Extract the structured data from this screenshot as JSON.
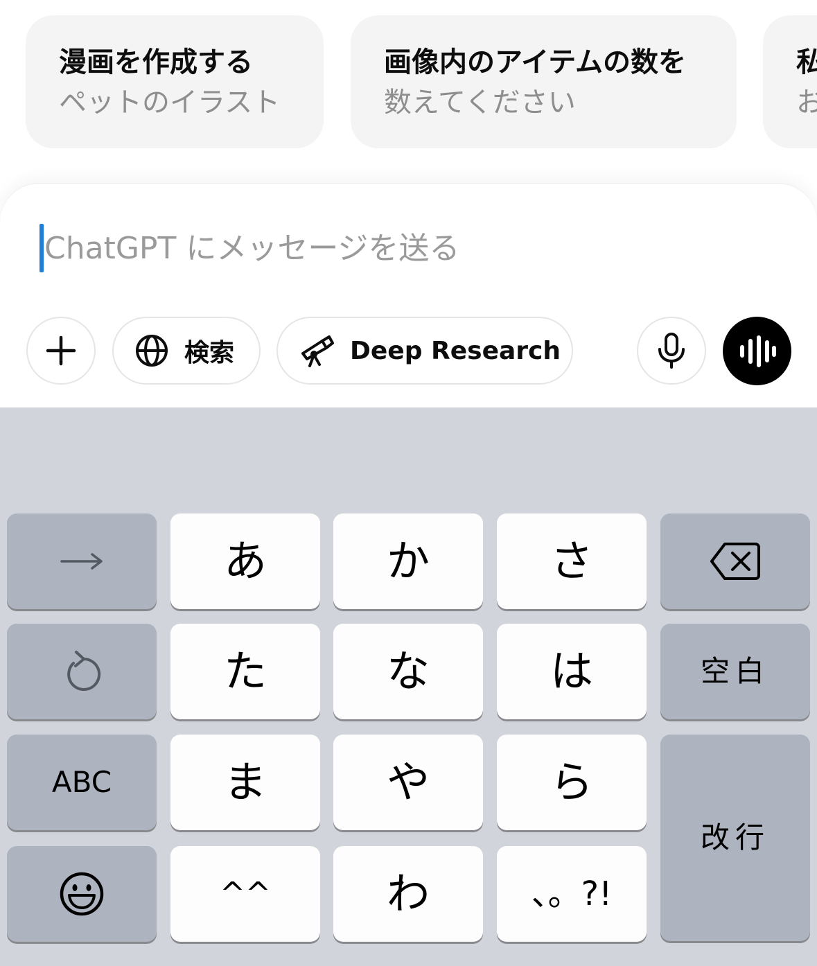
{
  "suggestions": [
    {
      "title": "漫画を作成する",
      "subtitle": "ペットのイラスト"
    },
    {
      "title": "画像内のアイテムの数を",
      "subtitle": "数えてください"
    },
    {
      "title": "私",
      "subtitle": "お"
    }
  ],
  "composer": {
    "placeholder": "ChatGPT にメッセージを送る",
    "search_label": "検索",
    "deep_research_label": "Deep Research"
  },
  "icons": {
    "add": "plus-icon",
    "search": "globe-icon",
    "deep_research": "telescope-icon",
    "dictation": "microphone-icon",
    "voice_mode": "voice-waveform-icon",
    "next": "arrow-right-icon",
    "undo": "undo-icon",
    "emoji": "smiley-icon",
    "delete": "backspace-icon"
  },
  "keyboard": {
    "rows": [
      [
        "あ",
        "か",
        "さ"
      ],
      [
        "た",
        "な",
        "は"
      ],
      [
        "ま",
        "や",
        "ら"
      ],
      [
        "^^",
        "わ",
        "、。?!"
      ]
    ],
    "abc_label": "ABC",
    "space_label": "空白",
    "return_label": "改行"
  },
  "colors": {
    "caret": "#1e7fd9",
    "keyboard_bg": "#d1d4db",
    "dark_key": "#adb3bf",
    "light_key": "#fdfdfd",
    "suggestion_bg": "#f4f4f4"
  }
}
